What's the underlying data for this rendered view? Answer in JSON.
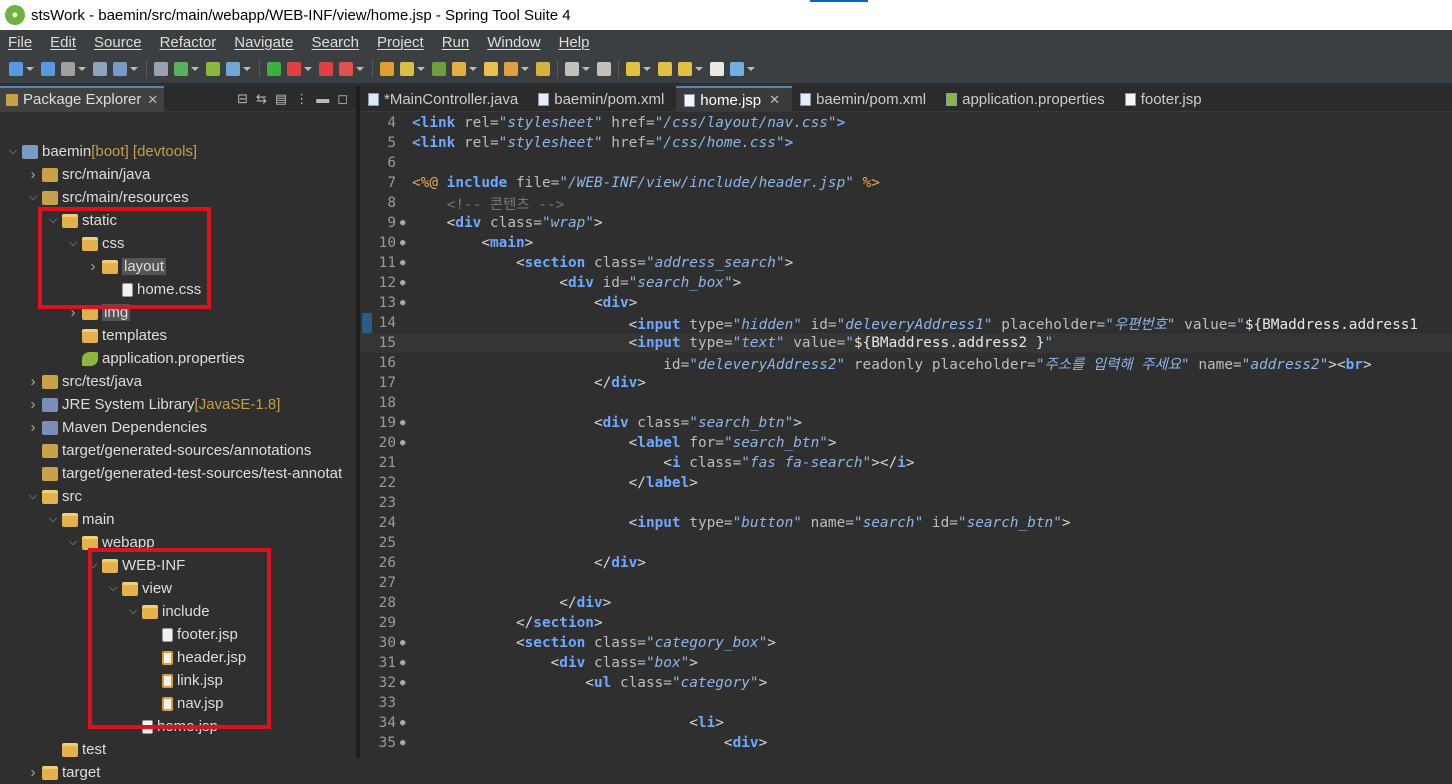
{
  "window": {
    "title": "stsWork - baemin/src/main/webapp/WEB-INF/view/home.jsp - Spring Tool Suite 4"
  },
  "menu": [
    "File",
    "Edit",
    "Source",
    "Refactor",
    "Navigate",
    "Search",
    "Project",
    "Run",
    "Window",
    "Help"
  ],
  "explorer": {
    "tab_label": "Package Explorer",
    "items": [
      {
        "label": "baemin",
        "deco": " [boot] [devtools]",
        "icon": "project-icon",
        "depth": 0,
        "twisty": "open"
      },
      {
        "label": "src/main/java",
        "deco": "",
        "icon": "package-folder-icon",
        "depth": 1,
        "twisty": "closed"
      },
      {
        "label": "src/main/resources",
        "deco": "",
        "icon": "package-folder-icon",
        "depth": 1,
        "twisty": "open"
      },
      {
        "label": "static",
        "deco": "",
        "icon": "folder-icon",
        "depth": 2,
        "twisty": "open"
      },
      {
        "label": "css",
        "deco": "",
        "icon": "folder-icon",
        "depth": 3,
        "twisty": "open"
      },
      {
        "label": "layout",
        "deco": "",
        "icon": "folder-icon",
        "depth": 4,
        "twisty": "closed",
        "selected": true
      },
      {
        "label": "home.css",
        "deco": "",
        "icon": "file-icon",
        "depth": 5,
        "twisty": ""
      },
      {
        "label": "img",
        "deco": "",
        "icon": "folder-icon",
        "depth": 3,
        "twisty": "closed",
        "selected": true
      },
      {
        "label": "templates",
        "deco": "",
        "icon": "folder-icon",
        "depth": 3,
        "twisty": ""
      },
      {
        "label": "application.properties",
        "deco": "",
        "icon": "properties-icon",
        "depth": 3,
        "twisty": ""
      },
      {
        "label": "src/test/java",
        "deco": "",
        "icon": "package-folder-icon",
        "depth": 1,
        "twisty": "closed"
      },
      {
        "label": "JRE System Library",
        "deco": " [JavaSE-1.8]",
        "icon": "library-icon",
        "depth": 1,
        "twisty": "closed"
      },
      {
        "label": "Maven Dependencies",
        "deco": "",
        "icon": "library-icon",
        "depth": 1,
        "twisty": "closed"
      },
      {
        "label": "target/generated-sources/annotations",
        "deco": "",
        "icon": "package-folder-icon",
        "depth": 1,
        "twisty": ""
      },
      {
        "label": "target/generated-test-sources/test-annotat",
        "deco": "",
        "icon": "package-folder-icon",
        "depth": 1,
        "twisty": ""
      },
      {
        "label": "src",
        "deco": "",
        "icon": "folder-icon",
        "depth": 1,
        "twisty": "open"
      },
      {
        "label": "main",
        "deco": "",
        "icon": "folder-icon",
        "depth": 2,
        "twisty": "open"
      },
      {
        "label": "webapp",
        "deco": "",
        "icon": "folder-icon",
        "depth": 3,
        "twisty": "open"
      },
      {
        "label": "WEB-INF",
        "deco": "",
        "icon": "folder-icon",
        "depth": 4,
        "twisty": "open"
      },
      {
        "label": "view",
        "deco": "",
        "icon": "folder-icon",
        "depth": 5,
        "twisty": "open"
      },
      {
        "label": "include",
        "deco": "",
        "icon": "folder-icon",
        "depth": 6,
        "twisty": "open"
      },
      {
        "label": "footer.jsp",
        "deco": "",
        "icon": "file-icon",
        "depth": 7,
        "twisty": ""
      },
      {
        "label": "header.jsp",
        "deco": "",
        "icon": "jsp-icon",
        "depth": 7,
        "twisty": ""
      },
      {
        "label": "link.jsp",
        "deco": "",
        "icon": "jsp-icon",
        "depth": 7,
        "twisty": ""
      },
      {
        "label": "nav.jsp",
        "deco": "",
        "icon": "jsp-icon",
        "depth": 7,
        "twisty": ""
      },
      {
        "label": "home.jsp",
        "deco": "",
        "icon": "file-icon",
        "depth": 6,
        "twisty": ""
      },
      {
        "label": "test",
        "deco": "",
        "icon": "folder-icon",
        "depth": 2,
        "twisty": ""
      },
      {
        "label": "target",
        "deco": "",
        "icon": "folder-icon",
        "depth": 1,
        "twisty": "closed"
      }
    ]
  },
  "editor_tabs": [
    {
      "label": "*MainController.java",
      "icon": "java-file-icon",
      "active": false
    },
    {
      "label": "baemin/pom.xml",
      "icon": "maven-file-icon",
      "active": false
    },
    {
      "label": "home.jsp",
      "icon": "jsp-file-icon",
      "active": true
    },
    {
      "label": "baemin/pom.xml",
      "icon": "maven-file-icon",
      "active": false
    },
    {
      "label": "application.properties",
      "icon": "properties-icon",
      "active": false
    },
    {
      "label": "footer.jsp",
      "icon": "jsp-file-icon",
      "active": false
    }
  ],
  "code_lines": [
    {
      "n": "4",
      "fold": "",
      "segs": [
        [
          "t",
          "<link"
        ],
        [
          "e",
          " "
        ],
        [
          "a",
          "rel="
        ],
        [
          "s",
          "\"stylesheet\""
        ],
        [
          "e",
          " "
        ],
        [
          "a",
          "href="
        ],
        [
          "s",
          "\"/css/layout/nav.css\""
        ],
        [
          "t",
          ">"
        ]
      ]
    },
    {
      "n": "5",
      "fold": "",
      "segs": [
        [
          "t",
          "<link"
        ],
        [
          "e",
          " "
        ],
        [
          "a",
          "rel="
        ],
        [
          "s",
          "\"stylesheet\""
        ],
        [
          "e",
          " "
        ],
        [
          "a",
          "href="
        ],
        [
          "s",
          "\"/css/home.css\""
        ],
        [
          "t",
          ">"
        ]
      ]
    },
    {
      "n": "6",
      "fold": "",
      "segs": []
    },
    {
      "n": "7",
      "fold": "",
      "segs": [
        [
          "d",
          "<%@"
        ],
        [
          "e",
          " "
        ],
        [
          "t",
          "include"
        ],
        [
          "e",
          " "
        ],
        [
          "a",
          "file="
        ],
        [
          "s",
          "\"/WEB-INF/view/include/header.jsp\""
        ],
        [
          "e",
          " "
        ],
        [
          "d",
          "%>"
        ]
      ]
    },
    {
      "n": "8",
      "fold": "",
      "segs": [
        [
          "e",
          "    "
        ],
        [
          "c",
          "<!-- 콘텐츠 -->"
        ]
      ]
    },
    {
      "n": "9",
      "fold": "●",
      "segs": [
        [
          "e",
          "    "
        ],
        [
          "p",
          "<"
        ],
        [
          "t",
          "div"
        ],
        [
          "e",
          " "
        ],
        [
          "a",
          "class="
        ],
        [
          "s",
          "\"wrap\""
        ],
        [
          "p",
          ">"
        ]
      ]
    },
    {
      "n": "10",
      "fold": "●",
      "segs": [
        [
          "e",
          "        "
        ],
        [
          "p",
          "<"
        ],
        [
          "t",
          "main"
        ],
        [
          "p",
          ">"
        ]
      ]
    },
    {
      "n": "11",
      "fold": "●",
      "segs": [
        [
          "e",
          "            "
        ],
        [
          "p",
          "<"
        ],
        [
          "t",
          "section"
        ],
        [
          "e",
          " "
        ],
        [
          "a",
          "class="
        ],
        [
          "s",
          "\"address_search\""
        ],
        [
          "p",
          ">"
        ]
      ]
    },
    {
      "n": "12",
      "fold": "●",
      "segs": [
        [
          "e",
          "                 "
        ],
        [
          "p",
          "<"
        ],
        [
          "t",
          "div"
        ],
        [
          "e",
          " "
        ],
        [
          "a",
          "id="
        ],
        [
          "s",
          "\"search_box\""
        ],
        [
          "p",
          ">"
        ]
      ]
    },
    {
      "n": "13",
      "fold": "●",
      "segs": [
        [
          "e",
          "                     "
        ],
        [
          "p",
          "<"
        ],
        [
          "t",
          "div"
        ],
        [
          "p",
          ">"
        ]
      ]
    },
    {
      "n": "14",
      "fold": "",
      "segs": [
        [
          "e",
          "                         "
        ],
        [
          "p",
          "<"
        ],
        [
          "t",
          "input"
        ],
        [
          "e",
          " "
        ],
        [
          "a",
          "type="
        ],
        [
          "s",
          "\"hidden\""
        ],
        [
          "e",
          " "
        ],
        [
          "a",
          "id="
        ],
        [
          "s",
          "\"deleveryAddress1\""
        ],
        [
          "e",
          " "
        ],
        [
          "a",
          "placeholder="
        ],
        [
          "s",
          "\"우편번호\""
        ],
        [
          "e",
          " "
        ],
        [
          "a",
          "value="
        ],
        [
          "s",
          "\""
        ],
        [
          "e",
          "${BMaddress.address1"
        ]
      ]
    },
    {
      "n": "15",
      "fold": "",
      "segs": [
        [
          "e",
          "                         "
        ],
        [
          "p",
          "<"
        ],
        [
          "t",
          "input"
        ],
        [
          "e",
          " "
        ],
        [
          "a",
          "type="
        ],
        [
          "s",
          "\"text\""
        ],
        [
          "e",
          " "
        ],
        [
          "a",
          "value="
        ],
        [
          "s",
          "\""
        ],
        [
          "e",
          "${BMaddress.address2 }"
        ],
        [
          "s",
          "\""
        ]
      ]
    },
    {
      "n": "16",
      "fold": "",
      "segs": [
        [
          "e",
          "                             "
        ],
        [
          "a",
          "id="
        ],
        [
          "s",
          "\"deleveryAddress2\""
        ],
        [
          "e",
          " "
        ],
        [
          "a",
          "readonly"
        ],
        [
          "e",
          " "
        ],
        [
          "a",
          "placeholder="
        ],
        [
          "s",
          "\"주소를 입력해 주세요\""
        ],
        [
          "e",
          " "
        ],
        [
          "a",
          "name="
        ],
        [
          "s",
          "\"address2\""
        ],
        [
          "p",
          ">"
        ],
        [
          "p",
          "<"
        ],
        [
          "t",
          "br"
        ],
        [
          "p",
          ">"
        ]
      ]
    },
    {
      "n": "17",
      "fold": "",
      "segs": [
        [
          "e",
          "                     "
        ],
        [
          "p",
          "</"
        ],
        [
          "t",
          "div"
        ],
        [
          "p",
          ">"
        ]
      ]
    },
    {
      "n": "18",
      "fold": "",
      "segs": []
    },
    {
      "n": "19",
      "fold": "●",
      "segs": [
        [
          "e",
          "                     "
        ],
        [
          "p",
          "<"
        ],
        [
          "t",
          "div"
        ],
        [
          "e",
          " "
        ],
        [
          "a",
          "class="
        ],
        [
          "s",
          "\"search_btn\""
        ],
        [
          "p",
          ">"
        ]
      ]
    },
    {
      "n": "20",
      "fold": "●",
      "segs": [
        [
          "e",
          "                         "
        ],
        [
          "p",
          "<"
        ],
        [
          "t",
          "label"
        ],
        [
          "e",
          " "
        ],
        [
          "a",
          "for="
        ],
        [
          "s",
          "\"search_btn\""
        ],
        [
          "p",
          ">"
        ]
      ]
    },
    {
      "n": "21",
      "fold": "",
      "segs": [
        [
          "e",
          "                             "
        ],
        [
          "p",
          "<"
        ],
        [
          "t",
          "i"
        ],
        [
          "e",
          " "
        ],
        [
          "a",
          "class="
        ],
        [
          "s",
          "\"fas fa-search\""
        ],
        [
          "p",
          ">"
        ],
        [
          "p",
          "</"
        ],
        [
          "t",
          "i"
        ],
        [
          "p",
          ">"
        ]
      ]
    },
    {
      "n": "22",
      "fold": "",
      "segs": [
        [
          "e",
          "                         "
        ],
        [
          "p",
          "</"
        ],
        [
          "t",
          "label"
        ],
        [
          "p",
          ">"
        ]
      ]
    },
    {
      "n": "23",
      "fold": "",
      "segs": []
    },
    {
      "n": "24",
      "fold": "",
      "segs": [
        [
          "e",
          "                         "
        ],
        [
          "p",
          "<"
        ],
        [
          "t",
          "input"
        ],
        [
          "e",
          " "
        ],
        [
          "a",
          "type="
        ],
        [
          "s",
          "\"button\""
        ],
        [
          "e",
          " "
        ],
        [
          "a",
          "name="
        ],
        [
          "s",
          "\"search\""
        ],
        [
          "e",
          " "
        ],
        [
          "a",
          "id="
        ],
        [
          "s",
          "\"search_btn\""
        ],
        [
          "p",
          ">"
        ]
      ]
    },
    {
      "n": "25",
      "fold": "",
      "segs": []
    },
    {
      "n": "26",
      "fold": "",
      "segs": [
        [
          "e",
          "                     "
        ],
        [
          "p",
          "</"
        ],
        [
          "t",
          "div"
        ],
        [
          "p",
          ">"
        ]
      ]
    },
    {
      "n": "27",
      "fold": "",
      "segs": []
    },
    {
      "n": "28",
      "fold": "",
      "segs": [
        [
          "e",
          "                 "
        ],
        [
          "p",
          "</"
        ],
        [
          "t",
          "div"
        ],
        [
          "p",
          ">"
        ]
      ]
    },
    {
      "n": "29",
      "fold": "",
      "segs": [
        [
          "e",
          "            "
        ],
        [
          "p",
          "</"
        ],
        [
          "t",
          "section"
        ],
        [
          "p",
          ">"
        ]
      ]
    },
    {
      "n": "30",
      "fold": "●",
      "segs": [
        [
          "e",
          "            "
        ],
        [
          "p",
          "<"
        ],
        [
          "t",
          "section"
        ],
        [
          "e",
          " "
        ],
        [
          "a",
          "class="
        ],
        [
          "s",
          "\"category_box\""
        ],
        [
          "p",
          ">"
        ]
      ]
    },
    {
      "n": "31",
      "fold": "●",
      "segs": [
        [
          "e",
          "                "
        ],
        [
          "p",
          "<"
        ],
        [
          "t",
          "div"
        ],
        [
          "e",
          " "
        ],
        [
          "a",
          "class="
        ],
        [
          "s",
          "\"box\""
        ],
        [
          "p",
          ">"
        ]
      ]
    },
    {
      "n": "32",
      "fold": "●",
      "segs": [
        [
          "e",
          "                    "
        ],
        [
          "p",
          "<"
        ],
        [
          "t",
          "ul"
        ],
        [
          "e",
          " "
        ],
        [
          "a",
          "class="
        ],
        [
          "s",
          "\"category\""
        ],
        [
          "p",
          ">"
        ]
      ]
    },
    {
      "n": "33",
      "fold": "",
      "segs": []
    },
    {
      "n": "34",
      "fold": "●",
      "segs": [
        [
          "e",
          "                                "
        ],
        [
          "p",
          "<"
        ],
        [
          "t",
          "li"
        ],
        [
          "p",
          ">"
        ]
      ]
    },
    {
      "n": "35",
      "fold": "●",
      "segs": [
        [
          "e",
          "                                    "
        ],
        [
          "p",
          "<"
        ],
        [
          "t",
          "div"
        ],
        [
          "p",
          ">"
        ]
      ]
    }
  ]
}
